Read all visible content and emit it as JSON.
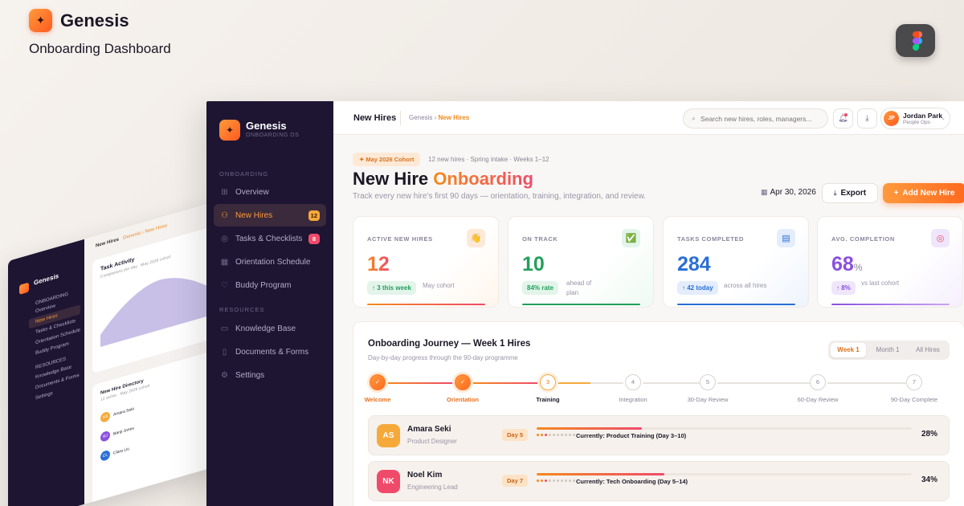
{
  "brand": {
    "name": "Genesis",
    "subtitle": "Onboarding Dashboard",
    "logo_icon": "sparkle-icon"
  },
  "colors": {
    "accent": "#ff9a3c",
    "accent_dark": "#ff5a1f",
    "sidebar_bg": "#1e1533",
    "pink": "#f04a6a",
    "green": "#22a05a",
    "blue": "#2a6fd6",
    "purple": "#8a4fe0"
  },
  "app": {
    "name": "Genesis",
    "tagline": "ONBOARDING OS"
  },
  "sidebar": {
    "section_onboarding": "ONBOARDING",
    "section_resources": "RESOURCES",
    "items": [
      {
        "label": "Overview",
        "icon": "grid-icon"
      },
      {
        "label": "New Hires",
        "icon": "users-icon",
        "badge": "12",
        "active": true
      },
      {
        "label": "Tasks & Checklists",
        "icon": "check-circle-icon",
        "badge": "8"
      },
      {
        "label": "Orientation Schedule",
        "icon": "calendar-icon"
      },
      {
        "label": "Buddy Program",
        "icon": "heart-icon"
      },
      {
        "label": "Knowledge Base",
        "icon": "book-icon"
      },
      {
        "label": "Documents & Forms",
        "icon": "document-icon"
      },
      {
        "label": "Settings",
        "icon": "gear-icon"
      }
    ]
  },
  "topbar": {
    "title": "New Hires",
    "crumb_root": "Genesis",
    "crumb_sep": "›",
    "crumb_current": "New Hires",
    "search_placeholder": "Search new hires, roles, managers...",
    "user": {
      "initials": "JP",
      "name": "Jordan Park",
      "role": "People Ops"
    }
  },
  "hero": {
    "cohort_badge": "✦ May 2026 Cohort",
    "cohort_meta": "12 new hires · Spring intake · Weeks 1–12",
    "title_plain": "New Hire",
    "title_accent": "Onboarding",
    "lead": "Track every new hire's first 90 days — orientation, training, integration, and review.",
    "date": "Apr 30, 2026",
    "export_label": "Export",
    "add_label": "Add New Hire"
  },
  "kpis": [
    {
      "label": "ACTIVE NEW HIRES",
      "value": "12",
      "unit": "",
      "change": "↑ 3 this week",
      "note": "May cohort",
      "icon": "wave-icon",
      "icon_glyph": "👋"
    },
    {
      "label": "ON TRACK",
      "value": "10",
      "unit": "",
      "change": "84% rate",
      "note": "ahead of plan",
      "icon": "check-box-icon",
      "icon_glyph": "✅"
    },
    {
      "label": "TASKS COMPLETED",
      "value": "284",
      "unit": "",
      "change": "↑ 42 today",
      "note": "across all hires",
      "icon": "clipboard-icon",
      "icon_glyph": "▤"
    },
    {
      "label": "AVG. COMPLETION",
      "value": "68",
      "unit": "%",
      "change": "↑ 8%",
      "note": "vs last cohort",
      "icon": "target-icon",
      "icon_glyph": "◎"
    }
  ],
  "journey": {
    "title": "Onboarding Journey — Week 1 Hires",
    "subtitle": "Day-by-day progress through the 90-day programme",
    "tabs": [
      "Week 1",
      "Month 1",
      "All Hires"
    ],
    "active_tab": "Week 1",
    "steps": [
      {
        "num": "✓",
        "label": "Welcome",
        "state": "done"
      },
      {
        "num": "✓",
        "label": "Orientation",
        "state": "done"
      },
      {
        "num": "3",
        "label": "Training",
        "state": "current"
      },
      {
        "num": "4",
        "label": "Integration",
        "state": "todo"
      },
      {
        "num": "5",
        "label": "30-Day Review",
        "state": "todo"
      },
      {
        "num": "6",
        "label": "60-Day Review",
        "state": "todo"
      },
      {
        "num": "7",
        "label": "90-Day Complete",
        "state": "todo"
      }
    ],
    "hires": [
      {
        "initials": "AS",
        "name": "Amara Seki",
        "role": "Product Designer",
        "day": "Day 5",
        "current": "Currently: Product Training (Day 3–10)",
        "progress": 0.28,
        "pct": "28%",
        "avatar_color": "#f6a93b"
      },
      {
        "initials": "NK",
        "name": "Noel Kim",
        "role": "Engineering Lead",
        "day": "Day 7",
        "current": "Currently: Tech Onboarding (Day 5–14)",
        "progress": 0.34,
        "pct": "34%",
        "avatar_color": "#f04a6a"
      }
    ]
  },
  "back_mockup": {
    "app": "Genesis",
    "header": "New Hires",
    "crumb": "Genesis › New Hires",
    "nav": [
      "ONBOARDING",
      "Overview",
      "New Hires",
      "Tasks & Checklists",
      "Orientation Schedule",
      "Buddy Program",
      "RESOURCES",
      "Knowledge Base",
      "Documents & Forms",
      "Settings"
    ],
    "activity_title": "Task Activity",
    "activity_sub": "Completions per day · May 2026 cohort",
    "directory_title": "New Hire Directory",
    "directory_sub": "12 active · May 2026 cohort",
    "people": [
      {
        "initials": "AS",
        "name": "Amara Seki",
        "role": "Product Designer"
      },
      {
        "initials": "BJ",
        "name": "Banji Jones",
        "role": "CS Engineer"
      },
      {
        "initials": "CL",
        "name": "Clara Liu",
        "role": "Visual Designer"
      }
    ]
  }
}
